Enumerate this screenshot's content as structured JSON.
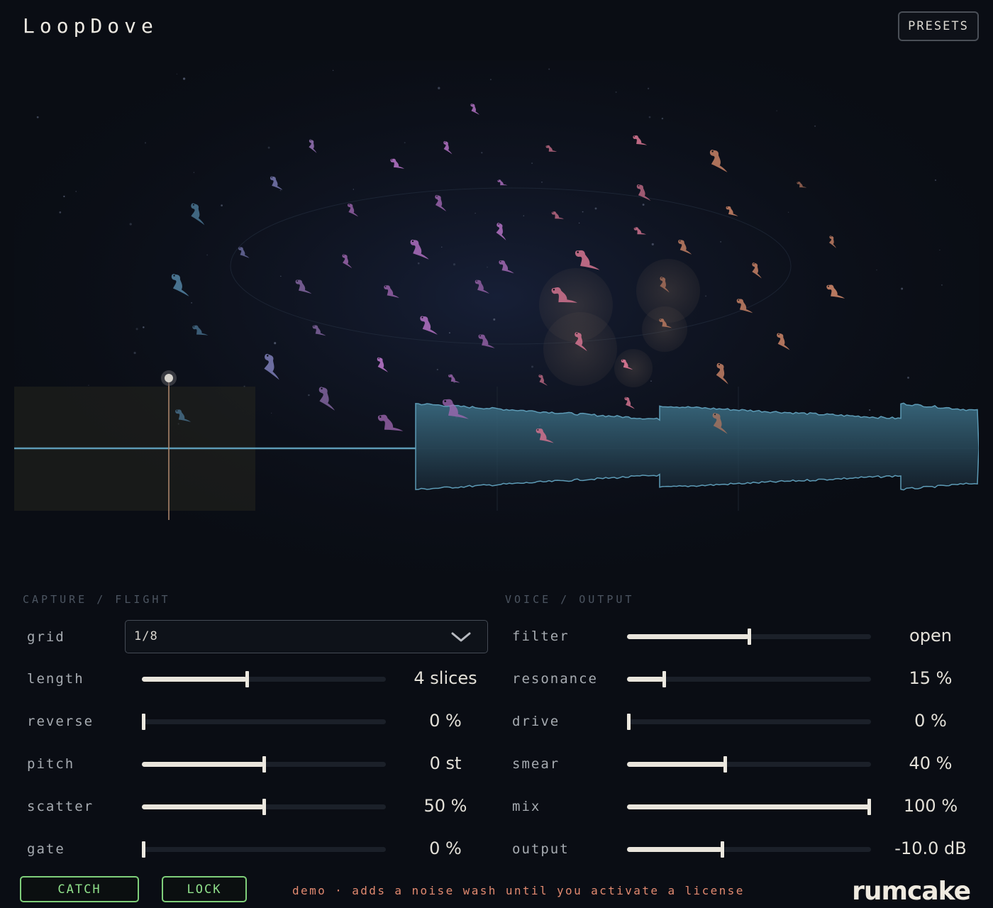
{
  "app": {
    "title": "LoopDove",
    "presets_label": "PRESETS"
  },
  "sections": {
    "left": "CAPTURE / FLIGHT",
    "right": "VOICE / OUTPUT"
  },
  "grid": {
    "label": "grid",
    "value": "1/8"
  },
  "left_params": [
    {
      "label": "length",
      "value": "4 slices",
      "level": 0.43
    },
    {
      "label": "reverse",
      "value": "0 %",
      "level": 0.0
    },
    {
      "label": "pitch",
      "value": "0 st",
      "level": 0.5
    },
    {
      "label": "scatter",
      "value": "50 %",
      "level": 0.5
    },
    {
      "label": "gate",
      "value": "0 %",
      "level": 0.0
    }
  ],
  "right_params": [
    {
      "label": "filter",
      "value": "open",
      "level": 0.5
    },
    {
      "label": "resonance",
      "value": "15 %",
      "level": 0.15
    },
    {
      "label": "drive",
      "value": "0 %",
      "level": 0.0
    },
    {
      "label": "smear",
      "value": "40 %",
      "level": 0.4
    },
    {
      "label": "mix",
      "value": "100 %",
      "level": 1.0
    },
    {
      "label": "output",
      "value": "-10.0 dB",
      "level": 0.39
    }
  ],
  "footer": {
    "catch_label": "CATCH",
    "lock_label": "LOCK",
    "demo_note": "demo · adds a noise wash until you activate a license",
    "brand": "rumcake"
  },
  "colors": {
    "accent_green": "#8fe08a",
    "demo_text": "#e28a70",
    "waveform": "#3d6f86",
    "dove_blue": "#4f7d9c",
    "dove_purple": "#a469b5",
    "dove_pink": "#d0728e",
    "dove_orange": "#b7785f"
  },
  "icons": {
    "dropdown": "chevron-down-icon",
    "dove": "dove-icon",
    "playhead": "playhead-icon"
  }
}
